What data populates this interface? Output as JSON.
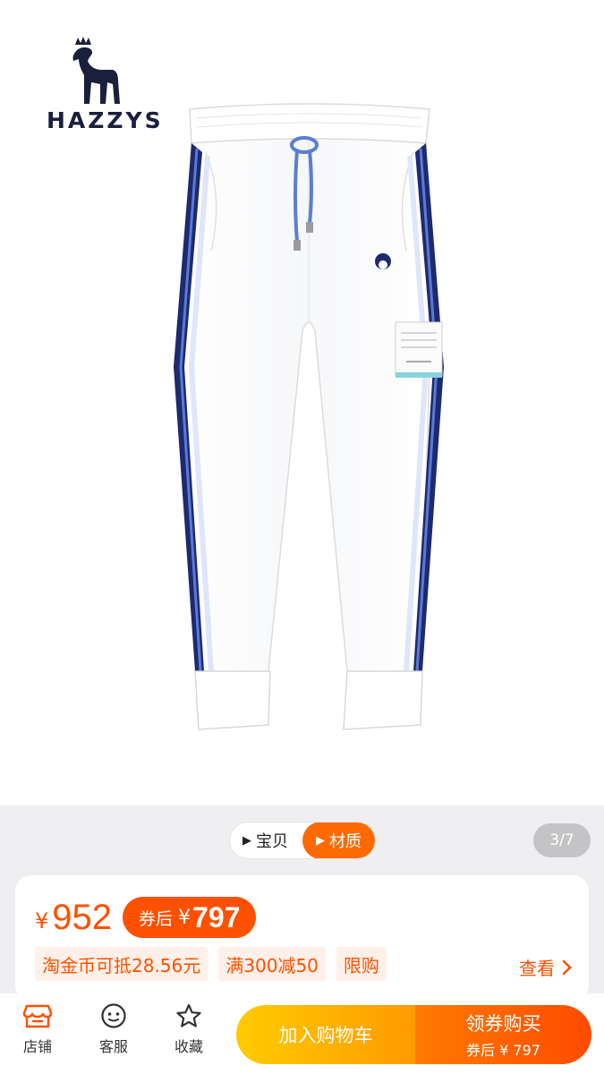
{
  "brand": {
    "name": "HAZZYS"
  },
  "gallery": {
    "tabs": [
      {
        "label": "宝贝",
        "active": false
      },
      {
        "label": "材质",
        "active": true
      }
    ],
    "counter": "3/7"
  },
  "price": {
    "currency": "¥",
    "original": "952",
    "coupon_label": "券后",
    "coupon_currency": "¥",
    "coupon_value": "797"
  },
  "promos": {
    "tags": [
      "淘金币可抵28.56元",
      "满300减50",
      "限购"
    ],
    "view_label": "查看"
  },
  "bottom_bar": {
    "store_label": "店铺",
    "service_label": "客服",
    "favorite_label": "收藏",
    "add_cart_label": "加入购物车",
    "buy_label": "领券购买",
    "buy_sub_label": "券后 ¥ 797"
  },
  "colors": {
    "accent": "#ff5000",
    "cart_gradient": [
      "#ffcb00",
      "#ff9a00"
    ],
    "buy_gradient": [
      "#ff7a00",
      "#ff4b00"
    ],
    "brand_navy": "#1a1f3c"
  }
}
